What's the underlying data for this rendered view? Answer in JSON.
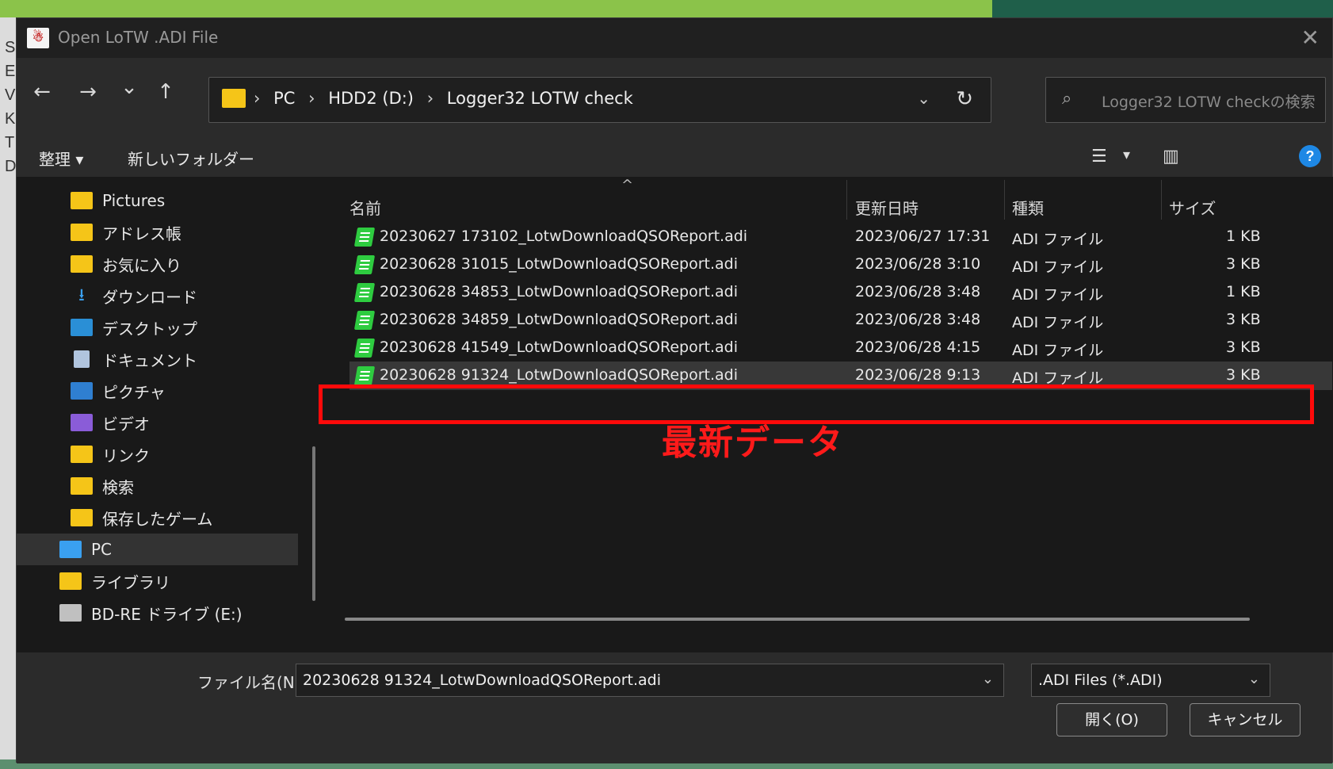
{
  "dialog": {
    "title": "Open LoTW .ADI File",
    "app_icon_glyph": "☃"
  },
  "nav": {
    "back_icon": "←",
    "forward_icon": "→",
    "recent_icon": "⌄",
    "up_icon": "↑",
    "breadcrumbs": [
      "PC",
      "HDD2 (D:)",
      "Logger32 LOTW check"
    ],
    "breadcrumb_sep": "›",
    "dropdown_icon": "⌄",
    "refresh_icon": "↻",
    "search_placeholder": "Logger32 LOTW checkの検索",
    "search_icon": "⌕"
  },
  "toolbar": {
    "organize": "整理 ▾",
    "new_folder": "新しいフォルダー",
    "view_icon": "☰",
    "view_dropdown": "▾",
    "preview_icon": "▥",
    "help": "?"
  },
  "sidebar": {
    "items": [
      {
        "label": "Pictures",
        "icon": "folder-icon",
        "color": "#f5c518"
      },
      {
        "label": "アドレス帳",
        "icon": "folder-icon",
        "color": "#f5c518"
      },
      {
        "label": "お気に入り",
        "icon": "folder-icon",
        "color": "#f5c518"
      },
      {
        "label": "ダウンロード",
        "icon": "download-icon",
        "color": "#3aa0f0"
      },
      {
        "label": "デスクトップ",
        "icon": "desktop-icon",
        "color": "#2a8fd6"
      },
      {
        "label": "ドキュメント",
        "icon": "document-icon",
        "color": "#b0c4de"
      },
      {
        "label": "ピクチャ",
        "icon": "pictures-icon",
        "color": "#2f7fd1"
      },
      {
        "label": "ビデオ",
        "icon": "video-icon",
        "color": "#8a5cd8"
      },
      {
        "label": "リンク",
        "icon": "folder-icon",
        "color": "#f5c518"
      },
      {
        "label": "検索",
        "icon": "folder-icon",
        "color": "#f5c518"
      },
      {
        "label": "保存したゲーム",
        "icon": "folder-icon",
        "color": "#f5c518"
      },
      {
        "label": "PC",
        "icon": "pc-icon",
        "color": "#3aa0f0"
      },
      {
        "label": "ライブラリ",
        "icon": "folder-icon",
        "color": "#f5c518"
      },
      {
        "label": "BD-RE ドライブ (E:)",
        "icon": "drive-icon",
        "color": "#c0c0c0"
      }
    ]
  },
  "filelist": {
    "sort_caret": "^",
    "columns": [
      "名前",
      "更新日時",
      "種類",
      "サイズ"
    ],
    "rows": [
      {
        "name": "20230627 173102_LotwDownloadQSOReport.adi",
        "date": "2023/06/27 17:31",
        "type": "ADI ファイル",
        "size": "1 KB"
      },
      {
        "name": "20230628 31015_LotwDownloadQSOReport.adi",
        "date": "2023/06/28 3:10",
        "type": "ADI ファイル",
        "size": "3 KB"
      },
      {
        "name": "20230628 34853_LotwDownloadQSOReport.adi",
        "date": "2023/06/28 3:48",
        "type": "ADI ファイル",
        "size": "1 KB"
      },
      {
        "name": "20230628 34859_LotwDownloadQSOReport.adi",
        "date": "2023/06/28 3:48",
        "type": "ADI ファイル",
        "size": "3 KB"
      },
      {
        "name": "20230628 41549_LotwDownloadQSOReport.adi",
        "date": "2023/06/28 4:15",
        "type": "ADI ファイル",
        "size": "3 KB"
      },
      {
        "name": "20230628 91324_LotwDownloadQSOReport.adi",
        "date": "2023/06/28 9:13",
        "type": "ADI ファイル",
        "size": "3 KB"
      }
    ],
    "annotation": "最新データ"
  },
  "bottom": {
    "filename_label": "ファイル名(N):",
    "filename_value": "20230628 91324_LotwDownloadQSOReport.adi",
    "filter_value": ".ADI Files (*.ADI)",
    "dropdown_icon": "⌄",
    "open_button": "開く(O)",
    "cancel_button": "キャンセル"
  },
  "background": {
    "left_letters": "S\nE\nV\nK\nT\nD"
  }
}
